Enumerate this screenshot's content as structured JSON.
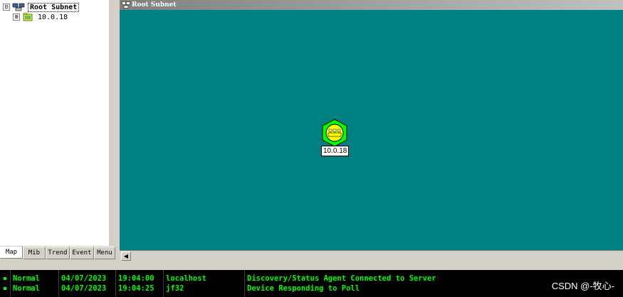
{
  "tree": {
    "root_label": "Root Subnet",
    "child_label": "10.0.18",
    "root_expander": "⊟",
    "child_expander": "⊞"
  },
  "tabs": [
    "Map",
    "Mib",
    "Trend",
    "Event",
    "Menu"
  ],
  "map_window": {
    "title": "Root Subnet",
    "device_label": "10.0.18",
    "background_color": "#008080",
    "device_color": "#00ff00"
  },
  "event_log": [
    {
      "status": "Normal",
      "date": "04/07/2023",
      "time": "19:04:00",
      "host": "localhost",
      "message": "Discovery/Status Agent Connected to Server"
    },
    {
      "status": "Normal",
      "date": "04/07/2023",
      "time": "19:04:25",
      "host": "jf32",
      "message": "Device Responding to Poll"
    }
  ],
  "watermark": "CSDN @-牧心-"
}
